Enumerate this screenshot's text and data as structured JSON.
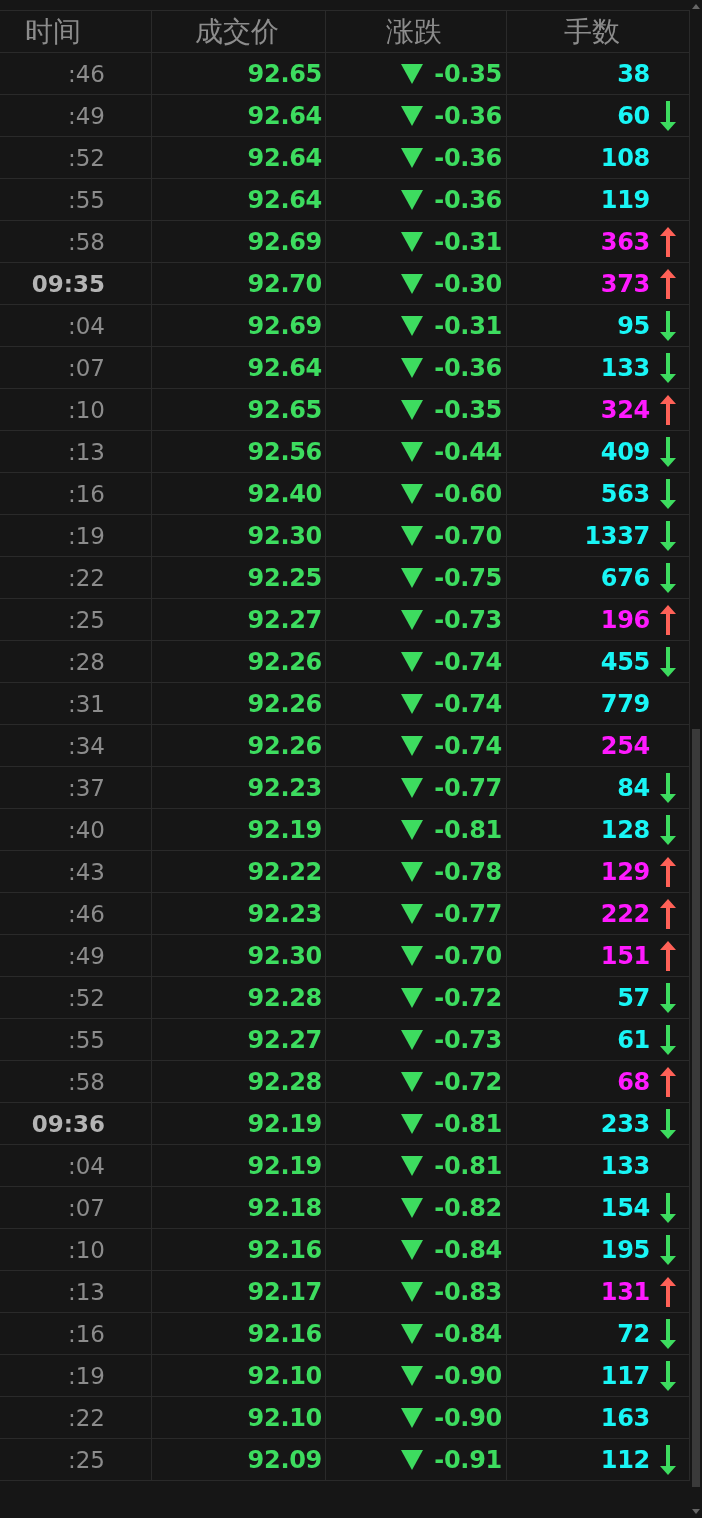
{
  "table": {
    "columns": [
      "时间",
      "成交价",
      "涨跌",
      "手数"
    ],
    "rows": [
      {
        "time": ":46",
        "kind": "second",
        "price": "92.65",
        "falling": true,
        "change": "-0.35",
        "volume": "38",
        "color": "#19f5f5",
        "up": false,
        "down": false
      },
      {
        "time": ":49",
        "kind": "second",
        "price": "92.64",
        "falling": true,
        "change": "-0.36",
        "volume": "60",
        "color": "#19f5f5",
        "up": false,
        "down": true
      },
      {
        "time": ":52",
        "kind": "second",
        "price": "92.64",
        "falling": true,
        "change": "-0.36",
        "volume": "108",
        "color": "#19f5f5",
        "up": false,
        "down": false
      },
      {
        "time": ":55",
        "kind": "second",
        "price": "92.64",
        "falling": true,
        "change": "-0.36",
        "volume": "119",
        "color": "#19f5f5",
        "up": false,
        "down": false
      },
      {
        "time": ":58",
        "kind": "second",
        "price": "92.69",
        "falling": true,
        "change": "-0.31",
        "volume": "363",
        "color": "#ff1aff",
        "up": true,
        "down": false
      },
      {
        "time": "09:35",
        "kind": "minute",
        "price": "92.70",
        "falling": true,
        "change": "-0.30",
        "volume": "373",
        "color": "#ff1aff",
        "up": true,
        "down": false
      },
      {
        "time": ":04",
        "kind": "second",
        "price": "92.69",
        "falling": true,
        "change": "-0.31",
        "volume": "95",
        "color": "#19f5f5",
        "up": false,
        "down": true
      },
      {
        "time": ":07",
        "kind": "second",
        "price": "92.64",
        "falling": true,
        "change": "-0.36",
        "volume": "133",
        "color": "#19f5f5",
        "up": false,
        "down": true
      },
      {
        "time": ":10",
        "kind": "second",
        "price": "92.65",
        "falling": true,
        "change": "-0.35",
        "volume": "324",
        "color": "#ff1aff",
        "up": true,
        "down": false
      },
      {
        "time": ":13",
        "kind": "second",
        "price": "92.56",
        "falling": true,
        "change": "-0.44",
        "volume": "409",
        "color": "#19f5f5",
        "up": false,
        "down": true
      },
      {
        "time": ":16",
        "kind": "second",
        "price": "92.40",
        "falling": true,
        "change": "-0.60",
        "volume": "563",
        "color": "#19f5f5",
        "up": false,
        "down": true
      },
      {
        "time": ":19",
        "kind": "second",
        "price": "92.30",
        "falling": true,
        "change": "-0.70",
        "volume": "1337",
        "color": "#19f5f5",
        "up": false,
        "down": true
      },
      {
        "time": ":22",
        "kind": "second",
        "price": "92.25",
        "falling": true,
        "change": "-0.75",
        "volume": "676",
        "color": "#19f5f5",
        "up": false,
        "down": true
      },
      {
        "time": ":25",
        "kind": "second",
        "price": "92.27",
        "falling": true,
        "change": "-0.73",
        "volume": "196",
        "color": "#ff1aff",
        "up": true,
        "down": false
      },
      {
        "time": ":28",
        "kind": "second",
        "price": "92.26",
        "falling": true,
        "change": "-0.74",
        "volume": "455",
        "color": "#19f5f5",
        "up": false,
        "down": true
      },
      {
        "time": ":31",
        "kind": "second",
        "price": "92.26",
        "falling": true,
        "change": "-0.74",
        "volume": "779",
        "color": "#19f5f5",
        "up": false,
        "down": false
      },
      {
        "time": ":34",
        "kind": "second",
        "price": "92.26",
        "falling": true,
        "change": "-0.74",
        "volume": "254",
        "color": "#ff1aff",
        "up": false,
        "down": false
      },
      {
        "time": ":37",
        "kind": "second",
        "price": "92.23",
        "falling": true,
        "change": "-0.77",
        "volume": "84",
        "color": "#19f5f5",
        "up": false,
        "down": true
      },
      {
        "time": ":40",
        "kind": "second",
        "price": "92.19",
        "falling": true,
        "change": "-0.81",
        "volume": "128",
        "color": "#19f5f5",
        "up": false,
        "down": true
      },
      {
        "time": ":43",
        "kind": "second",
        "price": "92.22",
        "falling": true,
        "change": "-0.78",
        "volume": "129",
        "color": "#ff1aff",
        "up": true,
        "down": false
      },
      {
        "time": ":46",
        "kind": "second",
        "price": "92.23",
        "falling": true,
        "change": "-0.77",
        "volume": "222",
        "color": "#ff1aff",
        "up": true,
        "down": false
      },
      {
        "time": ":49",
        "kind": "second",
        "price": "92.30",
        "falling": true,
        "change": "-0.70",
        "volume": "151",
        "color": "#ff1aff",
        "up": true,
        "down": false
      },
      {
        "time": ":52",
        "kind": "second",
        "price": "92.28",
        "falling": true,
        "change": "-0.72",
        "volume": "57",
        "color": "#19f5f5",
        "up": false,
        "down": true
      },
      {
        "time": ":55",
        "kind": "second",
        "price": "92.27",
        "falling": true,
        "change": "-0.73",
        "volume": "61",
        "color": "#19f5f5",
        "up": false,
        "down": true
      },
      {
        "time": ":58",
        "kind": "second",
        "price": "92.28",
        "falling": true,
        "change": "-0.72",
        "volume": "68",
        "color": "#ff1aff",
        "up": true,
        "down": false
      },
      {
        "time": "09:36",
        "kind": "minute",
        "price": "92.19",
        "falling": true,
        "change": "-0.81",
        "volume": "233",
        "color": "#19f5f5",
        "up": false,
        "down": true
      },
      {
        "time": ":04",
        "kind": "second",
        "price": "92.19",
        "falling": true,
        "change": "-0.81",
        "volume": "133",
        "color": "#19f5f5",
        "up": false,
        "down": false
      },
      {
        "time": ":07",
        "kind": "second",
        "price": "92.18",
        "falling": true,
        "change": "-0.82",
        "volume": "154",
        "color": "#19f5f5",
        "up": false,
        "down": true
      },
      {
        "time": ":10",
        "kind": "second",
        "price": "92.16",
        "falling": true,
        "change": "-0.84",
        "volume": "195",
        "color": "#19f5f5",
        "up": false,
        "down": true
      },
      {
        "time": ":13",
        "kind": "second",
        "price": "92.17",
        "falling": true,
        "change": "-0.83",
        "volume": "131",
        "color": "#ff1aff",
        "up": true,
        "down": false
      },
      {
        "time": ":16",
        "kind": "second",
        "price": "92.16",
        "falling": true,
        "change": "-0.84",
        "volume": "72",
        "color": "#19f5f5",
        "up": false,
        "down": true
      },
      {
        "time": ":19",
        "kind": "second",
        "price": "92.10",
        "falling": true,
        "change": "-0.90",
        "volume": "117",
        "color": "#19f5f5",
        "up": false,
        "down": true
      },
      {
        "time": ":22",
        "kind": "second",
        "price": "92.10",
        "falling": true,
        "change": "-0.90",
        "volume": "163",
        "color": "#19f5f5",
        "up": false,
        "down": false
      },
      {
        "time": ":25",
        "kind": "second",
        "price": "92.09",
        "falling": true,
        "change": "-0.91",
        "volume": "112",
        "color": "#19f5f5",
        "up": false,
        "down": true
      }
    ]
  }
}
